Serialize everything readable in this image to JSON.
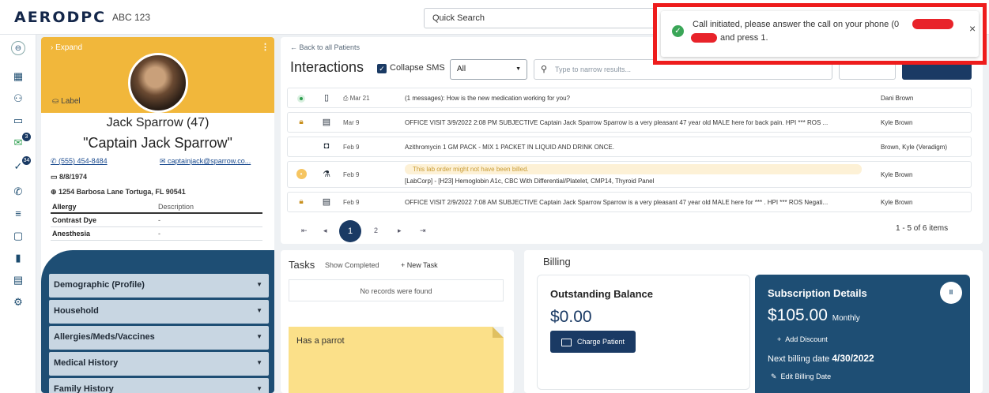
{
  "header": {
    "logo": "AERODPC",
    "org": "ABC 123",
    "quick_search": "Quick Search"
  },
  "toast": {
    "message_line1": "Call initiated, please answer the call on your phone (0",
    "message_line2": "and press 1.",
    "close": "×"
  },
  "patient": {
    "expand": "Expand",
    "label": "Label",
    "name": "Jack Sparrow (47)",
    "nickname": "\"Captain Jack Sparrow\"",
    "phone": "(555) 454-8484",
    "email": "captainjack@sparrow.co...",
    "dob": "8/8/1974",
    "address": "1254 Barbosa Lane Tortuga, FL 90541",
    "allergy_headers": [
      "Allergy",
      "Description"
    ],
    "allergies": [
      {
        "name": "Contrast Dye",
        "desc": "-"
      },
      {
        "name": "Anesthesia",
        "desc": "-"
      }
    ],
    "sections": [
      "Demographic (Profile)",
      "Household",
      "Allergies/Meds/Vaccines",
      "Medical History",
      "Family History"
    ]
  },
  "interactions": {
    "back": "← Back to all Patients",
    "title": "Interactions",
    "collapse_label": "Collapse SMS",
    "filter_value": "All",
    "search_placeholder": "Type to narrow results...",
    "rows": [
      {
        "date": "Mar 21",
        "text": "(1 messages): How is the new medication working for you?",
        "provider": "Dani Brown"
      },
      {
        "date": "Mar 9",
        "text": "OFFICE VISIT 3/9/2022 2:08 PM SUBJECTIVE Captain Jack Sparrow Sparrow is a very pleasant 47 year old MALE here for back pain. HPI *** ROS ...",
        "provider": "Kyle Brown"
      },
      {
        "date": "Feb 9",
        "text": "Azithromycin 1 GM PACK - MIX 1 PACKET IN LIQUID AND DRINK ONCE.",
        "provider": "Brown, Kyle (Veradigm)"
      },
      {
        "date": "Feb 9",
        "warning": "This lab order might not have been billed.",
        "text": "[LabCorp] - [H23] Hemoglobin A1c, CBC With Differential/Platelet, CMP14, Thyroid Panel",
        "provider": "Kyle Brown"
      },
      {
        "date": "Feb 9",
        "text": "OFFICE VISIT 2/9/2022 7:08 AM SUBJECTIVE Captain Jack Sparrow Sparrow is a very pleasant 47 year old MALE here for *** . HPI *** ROS Negati...",
        "provider": "Kyle Brown"
      }
    ],
    "pages": [
      "1",
      "2"
    ],
    "count": "1 - 5 of 6 items"
  },
  "tasks": {
    "title": "Tasks",
    "show_completed": "Show Completed",
    "new_task": "New Task",
    "empty": "No records were found",
    "note": "Has a parrot"
  },
  "billing": {
    "title": "Billing",
    "outstanding_title": "Outstanding Balance",
    "outstanding_value": "$0.00",
    "charge": "Charge Patient",
    "sub_title": "Subscription Details",
    "sub_amount": "$105.00",
    "sub_period": "Monthly",
    "add_discount": "Add Discount",
    "next_billing_label": "Next billing date",
    "next_billing_date": "4/30/2022",
    "edit_billing": "Edit Billing Date",
    "pause": "II"
  }
}
